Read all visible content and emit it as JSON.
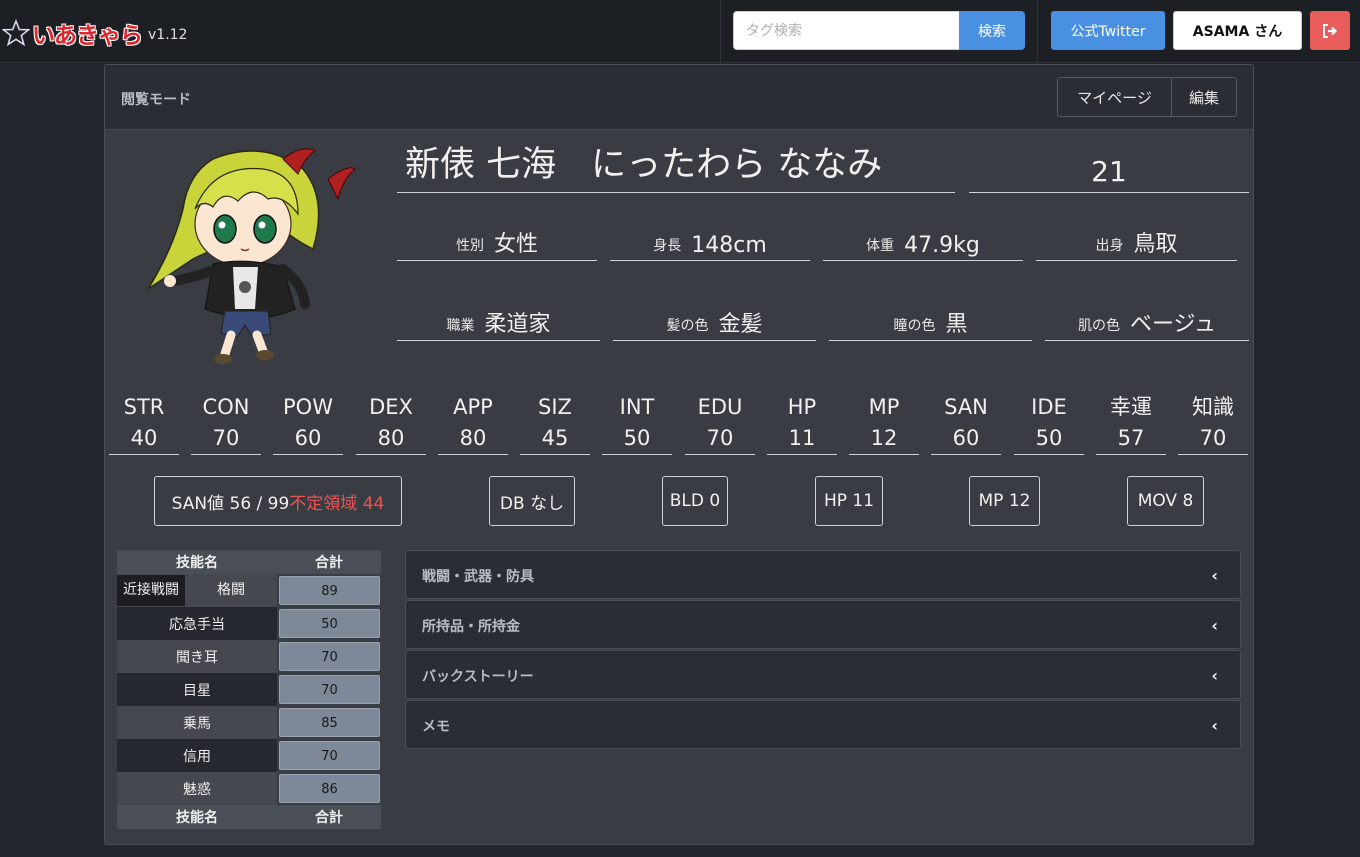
{
  "app": {
    "logo": "いあきゃら",
    "version": "v1.12"
  },
  "search": {
    "placeholder": "タグ検索",
    "button": "検索"
  },
  "nav": {
    "twitter": "公式Twitter",
    "user": "ASAMA さん",
    "logout_icon": "sign-out-icon"
  },
  "panel": {
    "mode": "閲覧モード",
    "mypage": "マイページ",
    "edit": "編集"
  },
  "character": {
    "name": "新俵 七海　にったわら ななみ",
    "age": "21",
    "profile": [
      {
        "label": "性別",
        "value": "女性"
      },
      {
        "label": "身長",
        "value": "148cm"
      },
      {
        "label": "体重",
        "value": "47.9kg"
      },
      {
        "label": "出身",
        "value": "鳥取"
      },
      {
        "label": "職業",
        "value": "柔道家"
      },
      {
        "label": "髪の色",
        "value": "金髪"
      },
      {
        "label": "瞳の色",
        "value": "黒"
      },
      {
        "label": "肌の色",
        "value": "ベージュ"
      }
    ]
  },
  "stats": [
    {
      "label": "STR",
      "value": "40"
    },
    {
      "label": "CON",
      "value": "70"
    },
    {
      "label": "POW",
      "value": "60"
    },
    {
      "label": "DEX",
      "value": "80"
    },
    {
      "label": "APP",
      "value": "80"
    },
    {
      "label": "SIZ",
      "value": "45"
    },
    {
      "label": "INT",
      "value": "50"
    },
    {
      "label": "EDU",
      "value": "70"
    },
    {
      "label": "HP",
      "value": "11"
    },
    {
      "label": "MP",
      "value": "12"
    },
    {
      "label": "SAN",
      "value": "60"
    },
    {
      "label": "IDE",
      "value": "50"
    },
    {
      "label": "幸運",
      "value": "57"
    },
    {
      "label": "知識",
      "value": "70"
    }
  ],
  "badges": {
    "san": "SAN値 56 / 99",
    "san_unstable": "不定領域 44",
    "db": "DB なし",
    "bld": "BLD 0",
    "hp": "HP 11",
    "mp": "MP 12",
    "mov": "MOV 8"
  },
  "skills": {
    "header_name": "技能名",
    "header_total": "合計",
    "rows": [
      {
        "category": "近接戦闘",
        "name": "格闘",
        "total": "89"
      },
      {
        "name": "応急手当",
        "total": "50"
      },
      {
        "name": "聞き耳",
        "total": "70"
      },
      {
        "name": "目星",
        "total": "70"
      },
      {
        "name": "乗馬",
        "total": "85"
      },
      {
        "name": "信用",
        "total": "70"
      },
      {
        "name": "魅惑",
        "total": "86"
      }
    ]
  },
  "sections": [
    "戦闘・武器・防具",
    "所持品・所持金",
    "バックストーリー",
    "メモ"
  ]
}
